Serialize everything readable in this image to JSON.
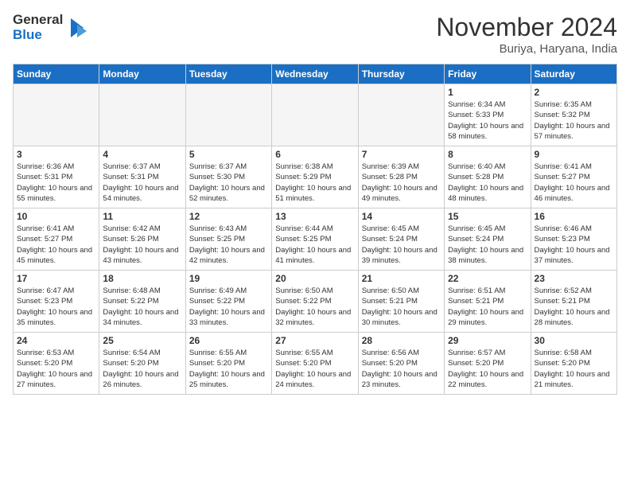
{
  "header": {
    "logo_line1": "General",
    "logo_line2": "Blue",
    "month": "November 2024",
    "location": "Buriya, Haryana, India"
  },
  "weekdays": [
    "Sunday",
    "Monday",
    "Tuesday",
    "Wednesday",
    "Thursday",
    "Friday",
    "Saturday"
  ],
  "weeks": [
    [
      {
        "day": "",
        "empty": true
      },
      {
        "day": "",
        "empty": true
      },
      {
        "day": "",
        "empty": true
      },
      {
        "day": "",
        "empty": true
      },
      {
        "day": "",
        "empty": true
      },
      {
        "day": "1",
        "sunrise": "6:34 AM",
        "sunset": "5:33 PM",
        "daylight": "10 hours and 58 minutes."
      },
      {
        "day": "2",
        "sunrise": "6:35 AM",
        "sunset": "5:32 PM",
        "daylight": "10 hours and 57 minutes."
      }
    ],
    [
      {
        "day": "3",
        "sunrise": "6:36 AM",
        "sunset": "5:31 PM",
        "daylight": "10 hours and 55 minutes."
      },
      {
        "day": "4",
        "sunrise": "6:37 AM",
        "sunset": "5:31 PM",
        "daylight": "10 hours and 54 minutes."
      },
      {
        "day": "5",
        "sunrise": "6:37 AM",
        "sunset": "5:30 PM",
        "daylight": "10 hours and 52 minutes."
      },
      {
        "day": "6",
        "sunrise": "6:38 AM",
        "sunset": "5:29 PM",
        "daylight": "10 hours and 51 minutes."
      },
      {
        "day": "7",
        "sunrise": "6:39 AM",
        "sunset": "5:28 PM",
        "daylight": "10 hours and 49 minutes."
      },
      {
        "day": "8",
        "sunrise": "6:40 AM",
        "sunset": "5:28 PM",
        "daylight": "10 hours and 48 minutes."
      },
      {
        "day": "9",
        "sunrise": "6:41 AM",
        "sunset": "5:27 PM",
        "daylight": "10 hours and 46 minutes."
      }
    ],
    [
      {
        "day": "10",
        "sunrise": "6:41 AM",
        "sunset": "5:27 PM",
        "daylight": "10 hours and 45 minutes."
      },
      {
        "day": "11",
        "sunrise": "6:42 AM",
        "sunset": "5:26 PM",
        "daylight": "10 hours and 43 minutes."
      },
      {
        "day": "12",
        "sunrise": "6:43 AM",
        "sunset": "5:25 PM",
        "daylight": "10 hours and 42 minutes."
      },
      {
        "day": "13",
        "sunrise": "6:44 AM",
        "sunset": "5:25 PM",
        "daylight": "10 hours and 41 minutes."
      },
      {
        "day": "14",
        "sunrise": "6:45 AM",
        "sunset": "5:24 PM",
        "daylight": "10 hours and 39 minutes."
      },
      {
        "day": "15",
        "sunrise": "6:45 AM",
        "sunset": "5:24 PM",
        "daylight": "10 hours and 38 minutes."
      },
      {
        "day": "16",
        "sunrise": "6:46 AM",
        "sunset": "5:23 PM",
        "daylight": "10 hours and 37 minutes."
      }
    ],
    [
      {
        "day": "17",
        "sunrise": "6:47 AM",
        "sunset": "5:23 PM",
        "daylight": "10 hours and 35 minutes."
      },
      {
        "day": "18",
        "sunrise": "6:48 AM",
        "sunset": "5:22 PM",
        "daylight": "10 hours and 34 minutes."
      },
      {
        "day": "19",
        "sunrise": "6:49 AM",
        "sunset": "5:22 PM",
        "daylight": "10 hours and 33 minutes."
      },
      {
        "day": "20",
        "sunrise": "6:50 AM",
        "sunset": "5:22 PM",
        "daylight": "10 hours and 32 minutes."
      },
      {
        "day": "21",
        "sunrise": "6:50 AM",
        "sunset": "5:21 PM",
        "daylight": "10 hours and 30 minutes."
      },
      {
        "day": "22",
        "sunrise": "6:51 AM",
        "sunset": "5:21 PM",
        "daylight": "10 hours and 29 minutes."
      },
      {
        "day": "23",
        "sunrise": "6:52 AM",
        "sunset": "5:21 PM",
        "daylight": "10 hours and 28 minutes."
      }
    ],
    [
      {
        "day": "24",
        "sunrise": "6:53 AM",
        "sunset": "5:20 PM",
        "daylight": "10 hours and 27 minutes."
      },
      {
        "day": "25",
        "sunrise": "6:54 AM",
        "sunset": "5:20 PM",
        "daylight": "10 hours and 26 minutes."
      },
      {
        "day": "26",
        "sunrise": "6:55 AM",
        "sunset": "5:20 PM",
        "daylight": "10 hours and 25 minutes."
      },
      {
        "day": "27",
        "sunrise": "6:55 AM",
        "sunset": "5:20 PM",
        "daylight": "10 hours and 24 minutes."
      },
      {
        "day": "28",
        "sunrise": "6:56 AM",
        "sunset": "5:20 PM",
        "daylight": "10 hours and 23 minutes."
      },
      {
        "day": "29",
        "sunrise": "6:57 AM",
        "sunset": "5:20 PM",
        "daylight": "10 hours and 22 minutes."
      },
      {
        "day": "30",
        "sunrise": "6:58 AM",
        "sunset": "5:20 PM",
        "daylight": "10 hours and 21 minutes."
      }
    ]
  ]
}
